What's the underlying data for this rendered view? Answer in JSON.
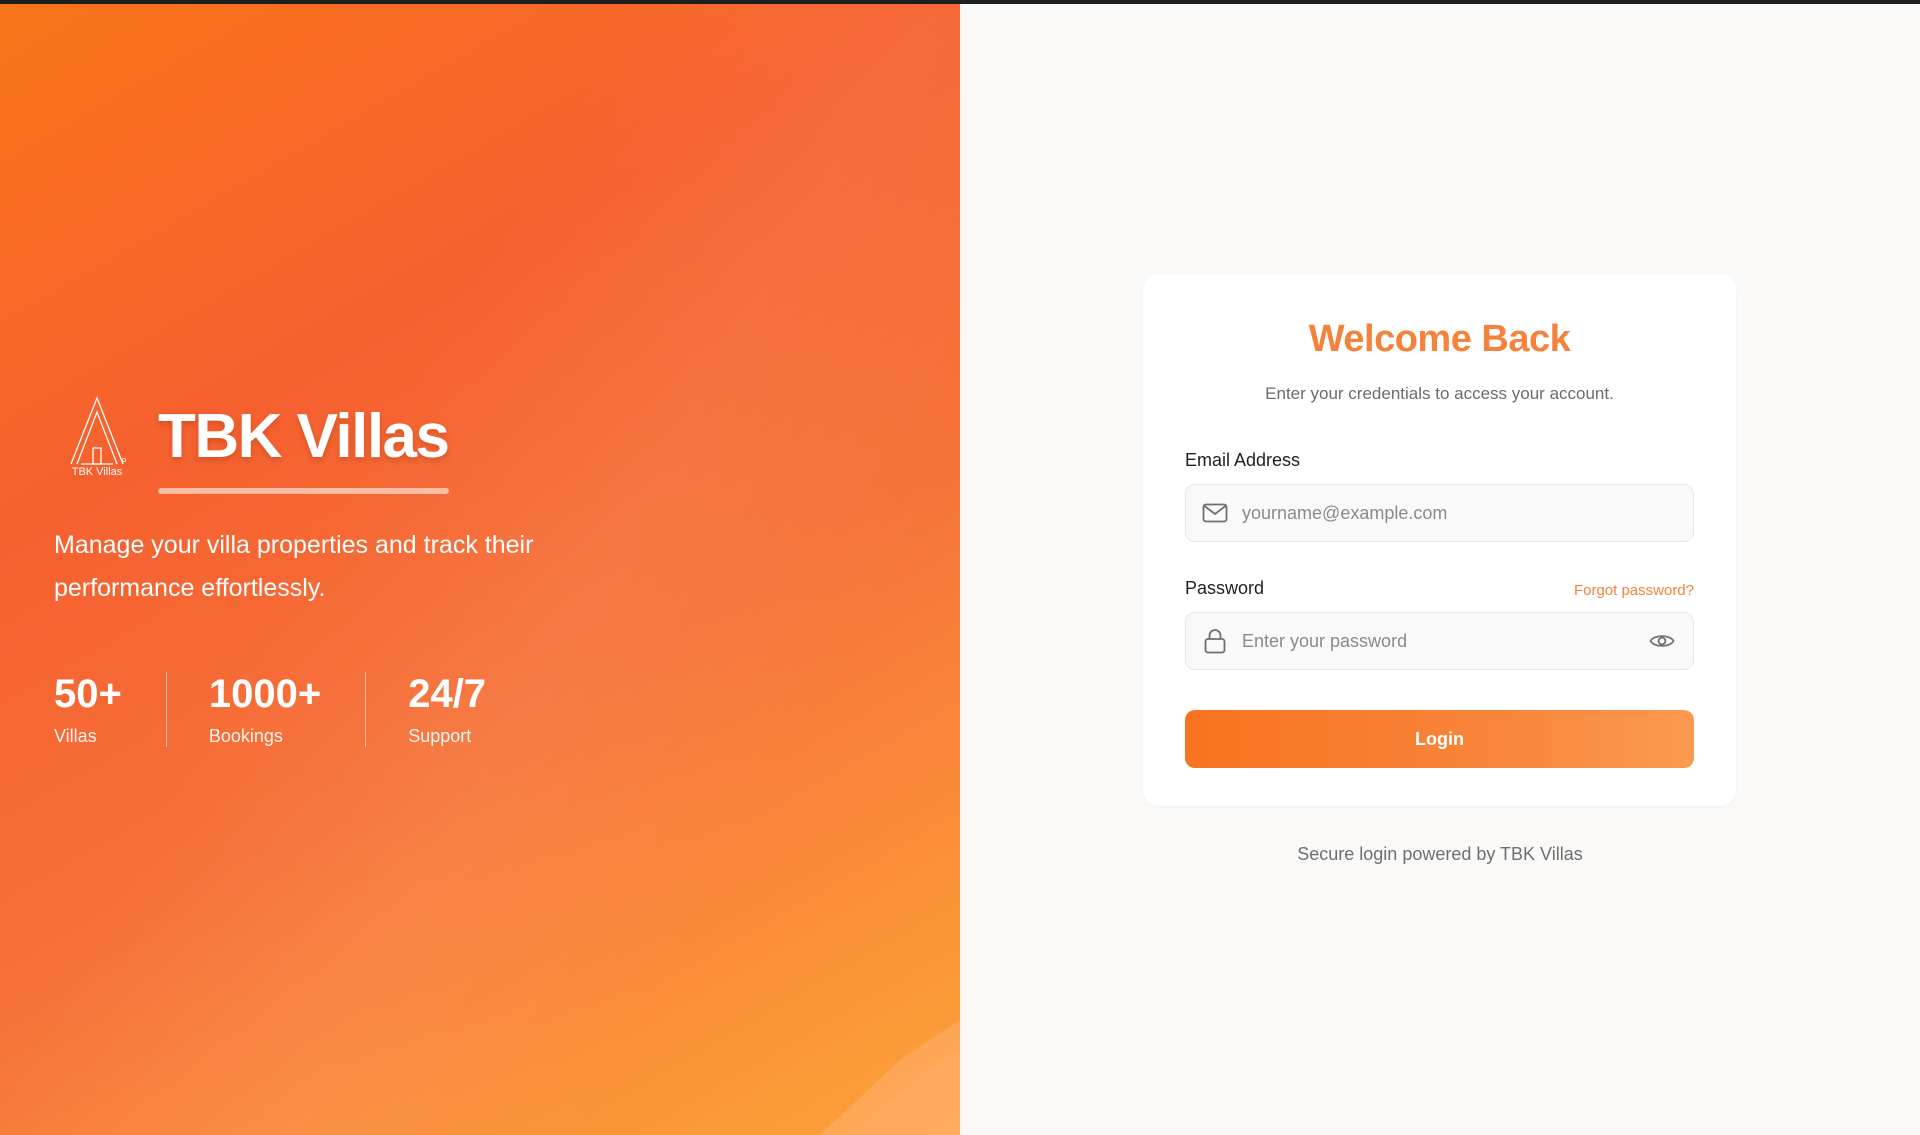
{
  "brand": {
    "name": "TBK Villas",
    "logo_text": "TBK Villas",
    "tagline": "Manage your villa properties and track their performance effortlessly."
  },
  "stats": [
    {
      "value": "50+",
      "label": "Villas"
    },
    {
      "value": "1000+",
      "label": "Bookings"
    },
    {
      "value": "24/7",
      "label": "Support"
    }
  ],
  "login": {
    "title": "Welcome Back",
    "subtitle": "Enter your credentials to access your account.",
    "email_label": "Email Address",
    "email_placeholder": "yourname@example.com",
    "email_value": "",
    "password_label": "Password",
    "password_placeholder": "Enter your password",
    "password_value": "",
    "forgot_label": "Forgot password?",
    "submit_label": "Login"
  },
  "footer": {
    "note": "Secure login powered by TBK Villas"
  },
  "colors": {
    "accent": "#f5823a",
    "panel_start": "#f97519",
    "panel_end": "#fda23a"
  },
  "icons": [
    "mail-icon",
    "lock-icon",
    "eye-icon",
    "tbk-villas-logo"
  ]
}
